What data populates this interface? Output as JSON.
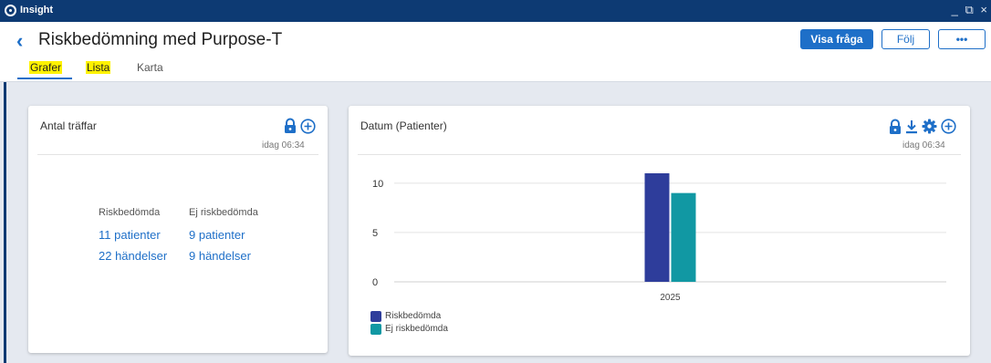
{
  "app": {
    "name": "Insight",
    "window_controls": "_ ⧉ ×"
  },
  "header": {
    "title": "Riskbedömning med Purpose-T",
    "buttons": {
      "show_query": "Visa fråga",
      "follow": "Följ",
      "more": "•••"
    },
    "tabs": [
      {
        "label": "Grafer"
      },
      {
        "label": "Lista"
      },
      {
        "label": "Karta"
      }
    ]
  },
  "hits_card": {
    "title": "Antal träffar",
    "timestamp": "idag 06:34",
    "columns": [
      {
        "heading": "Riskbedömda",
        "patients": "11 patienter",
        "events": "22 händelser"
      },
      {
        "heading": "Ej riskbedömda",
        "patients": "9 patienter",
        "events": "9 händelser"
      }
    ]
  },
  "chart_card": {
    "title": "Datum (Patienter)",
    "timestamp": "idag 06:34"
  },
  "colors": {
    "accent": "#1e6fc8",
    "titlebar": "#0d3a73",
    "series1": "#2e3d9b",
    "series2": "#1198a3"
  },
  "chart_data": {
    "type": "bar",
    "title": "Datum (Patienter)",
    "categories": [
      "2025"
    ],
    "series": [
      {
        "name": "Riskbedömda",
        "values": [
          11
        ],
        "color": "#2e3d9b"
      },
      {
        "name": "Ej riskbedömda",
        "values": [
          9
        ],
        "color": "#1198a3"
      }
    ],
    "ylim": [
      0,
      11
    ],
    "yticks": [
      0,
      5,
      10
    ],
    "grid": true,
    "legend": "bottom-left",
    "xlabel": "",
    "ylabel": ""
  }
}
